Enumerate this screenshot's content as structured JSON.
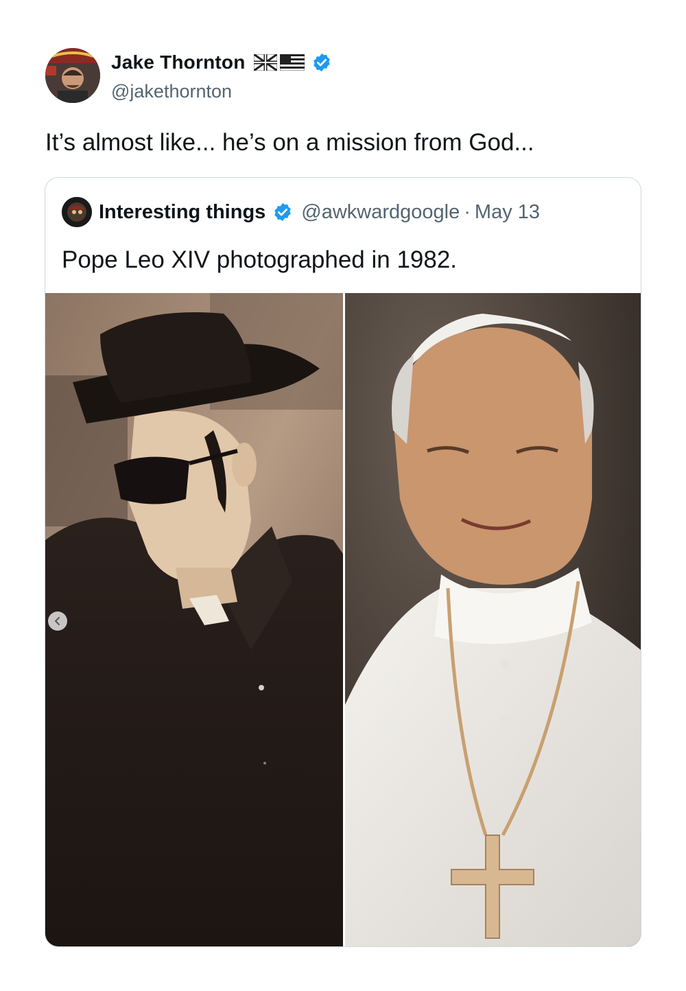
{
  "author": {
    "name": "Jake Thornton",
    "handle": "@jakethornton",
    "verified": true,
    "flag_icons": [
      "uk-flag-icon",
      "us-flag-icon"
    ],
    "avatar_icon": "profile-avatar"
  },
  "tweet": {
    "text": "It’s almost like... he’s on a mission from God..."
  },
  "quoted": {
    "name": "Interesting things",
    "handle": "@awkwardgoogle",
    "separator": "·",
    "date": "May 13",
    "verified": true,
    "text": "Pope Leo XIV photographed in 1982.",
    "media": [
      {
        "icon": "man-in-hat-sunglasses-photo"
      },
      {
        "icon": "pope-portrait-photo"
      }
    ],
    "carousel_icon": "chevron-left-icon"
  },
  "colors": {
    "text": "#0f1419",
    "secondary": "#536471",
    "verified": "#1d9bf0",
    "border": "#cfd9de"
  }
}
